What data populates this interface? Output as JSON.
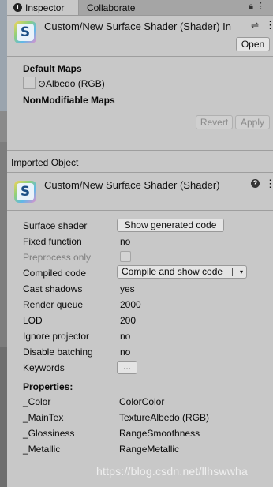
{
  "tabs": {
    "inspector": "Inspector",
    "collaborate": "Collaborate",
    "inspector_icon": "info-icon",
    "tools_icons": [
      "lock-icon",
      "kebab-menu-icon"
    ]
  },
  "header": {
    "title": "Custom/New Surface Shader (Shader) In",
    "open_button": "Open",
    "icon": "shader-icon",
    "icon_letter": "S"
  },
  "maps": {
    "default_title": "Default Maps",
    "albedo_label": "⊙Albedo (RGB)",
    "nonmod_title": "NonModifiable Maps",
    "revert": "Revert",
    "apply": "Apply"
  },
  "imported": {
    "section_title": "Imported Object",
    "title": "Custom/New Surface Shader (Shader)",
    "icons": [
      "help-icon",
      "settings-sliders-icon",
      "kebab-menu-icon"
    ]
  },
  "props": {
    "surface_shader": {
      "label": "Surface shader",
      "button": "Show generated code"
    },
    "fixed_function": {
      "label": "Fixed function",
      "value": "no"
    },
    "preprocess_only": {
      "label": "Preprocess only"
    },
    "compiled_code": {
      "label": "Compiled code",
      "button": "Compile and show code",
      "arrow": "▾"
    },
    "cast_shadows": {
      "label": "Cast shadows",
      "value": "yes"
    },
    "render_queue": {
      "label": "Render queue",
      "value": "2000"
    },
    "lod": {
      "label": "LOD",
      "value": "200"
    },
    "ignore_projector": {
      "label": "Ignore projector",
      "value": "no"
    },
    "disable_batching": {
      "label": "Disable batching",
      "value": "no"
    },
    "keywords": {
      "label": "Keywords",
      "button": "..."
    }
  },
  "properties": {
    "title": "Properties:",
    "rows": [
      {
        "name": "_Color",
        "value": "ColorColor"
      },
      {
        "name": "_MainTex",
        "value": "TextureAlbedo (RGB)"
      },
      {
        "name": "_Glossiness",
        "value": "RangeSmoothness"
      },
      {
        "name": "_Metallic",
        "value": "RangeMetallic"
      }
    ]
  },
  "watermark": "https://blog.csdn.net/llhswwha"
}
